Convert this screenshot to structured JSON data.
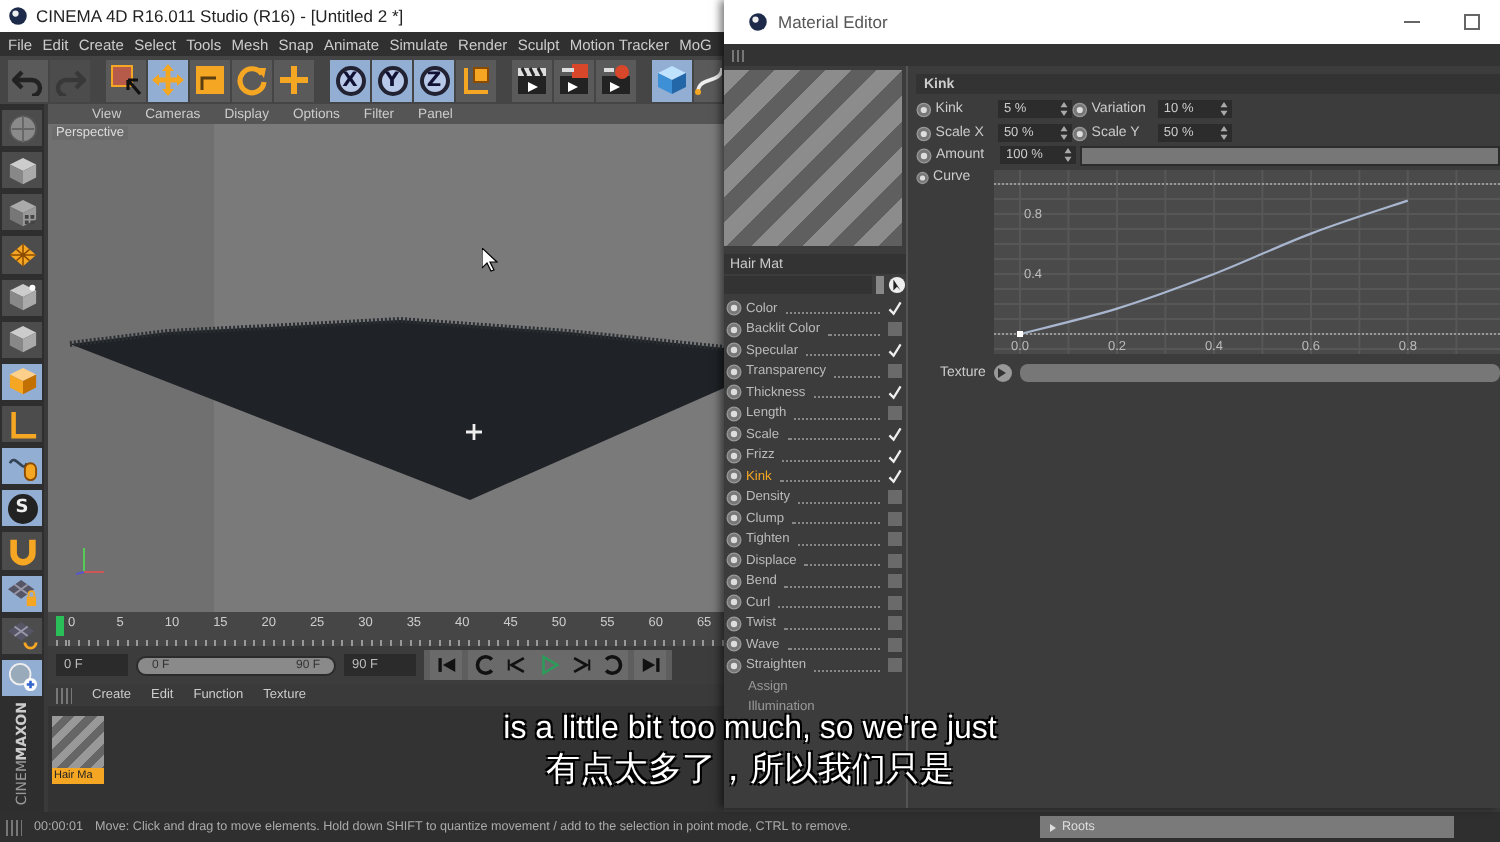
{
  "main_window": {
    "title": "CINEMA 4D R16.011 Studio (R16) - [Untitled 2 *]",
    "menu": [
      "File",
      "Edit",
      "Create",
      "Select",
      "Tools",
      "Mesh",
      "Snap",
      "Animate",
      "Simulate",
      "Render",
      "Sculpt",
      "Motion Tracker",
      "MoG"
    ],
    "toolbar": [
      {
        "kind": "undo",
        "selected": false,
        "disabled": false
      },
      {
        "kind": "redo",
        "selected": false,
        "disabled": true
      },
      {
        "kind": "select",
        "selected": false,
        "disabled": false
      },
      {
        "kind": "move",
        "selected": true,
        "disabled": false
      },
      {
        "kind": "scale",
        "selected": false,
        "disabled": false
      },
      {
        "kind": "rotate",
        "selected": false,
        "disabled": false
      },
      {
        "kind": "add",
        "selected": false,
        "disabled": false
      },
      {
        "kind": "axis",
        "label": "X",
        "selected": true,
        "disabled": false
      },
      {
        "kind": "axis",
        "label": "Y",
        "selected": true,
        "disabled": false
      },
      {
        "kind": "axis",
        "label": "Z",
        "selected": true,
        "disabled": false
      },
      {
        "kind": "coords",
        "selected": false,
        "disabled": false
      },
      {
        "kind": "render-view",
        "selected": false,
        "disabled": false
      },
      {
        "kind": "render",
        "selected": false,
        "disabled": false
      },
      {
        "kind": "render-settings",
        "selected": false,
        "disabled": false
      },
      {
        "kind": "cube",
        "selected": true,
        "disabled": false
      },
      {
        "kind": "spline",
        "selected": false,
        "disabled": false
      }
    ],
    "left_toolbar": [
      {
        "kind": "sphere",
        "selected": false
      },
      {
        "kind": "cube",
        "selected": false
      },
      {
        "kind": "checker-cube",
        "selected": false
      },
      {
        "kind": "texture",
        "selected": false
      },
      {
        "kind": "point-cube",
        "selected": false
      },
      {
        "kind": "cube",
        "selected": false
      },
      {
        "kind": "cube",
        "selected": true
      },
      {
        "kind": "axis-l",
        "selected": false
      },
      {
        "kind": "mouse",
        "selected": true
      },
      {
        "kind": "snap",
        "label": "S",
        "selected": true
      },
      {
        "kind": "magnet",
        "selected": false
      },
      {
        "kind": "grid-lock",
        "selected": true
      },
      {
        "kind": "grid",
        "selected": false
      },
      {
        "kind": "zoom",
        "selected": true
      }
    ],
    "logo": [
      "MAXON",
      "CINEM"
    ],
    "viewport": {
      "menu": [
        "View",
        "Cameras",
        "Display",
        "Options",
        "Filter",
        "Panel"
      ],
      "camera": "Perspective"
    },
    "timeline": {
      "labels": [
        "0",
        "5",
        "10",
        "15",
        "20",
        "25",
        "30",
        "35",
        "40",
        "45",
        "50",
        "55",
        "60",
        "65"
      ],
      "playhead": {
        "level": 0
      }
    },
    "time_controls": {
      "start": "0 F",
      "range": {
        "start": "0 F",
        "end": "90 F",
        "level": 1
      },
      "end": "90 F",
      "transport": [
        {
          "kind": "first"
        },
        {
          "kind": "previous-key"
        },
        {
          "kind": "step-back"
        },
        {
          "kind": "play"
        },
        {
          "kind": "step-forward"
        },
        {
          "kind": "next-key"
        },
        {
          "kind": "last"
        }
      ]
    },
    "material_manager": {
      "menu": [
        "Create",
        "Edit",
        "Function",
        "Texture"
      ],
      "materials": [
        {
          "name": "Hair Ma",
          "selected": true
        }
      ]
    },
    "status_bar": {
      "time": "00:00:01",
      "message": "Move: Click and drag to move elements. Hold down SHIFT to quantize movement / add to the selection in point mode, CTRL to remove.",
      "roots": "Roots"
    }
  },
  "material_editor": {
    "title": "Material Editor",
    "material_name": "Hair Mat",
    "channels": [
      {
        "name": "Color",
        "checked": true,
        "selected": false
      },
      {
        "name": "Backlit Color",
        "checked": false,
        "selected": false
      },
      {
        "name": "Specular",
        "checked": true,
        "selected": false
      },
      {
        "name": "Transparency",
        "checked": false,
        "selected": false
      },
      {
        "name": "Thickness",
        "checked": true,
        "selected": false
      },
      {
        "name": "Length",
        "checked": false,
        "selected": false
      },
      {
        "name": "Scale",
        "checked": true,
        "selected": false
      },
      {
        "name": "Frizz",
        "checked": true,
        "selected": false
      },
      {
        "name": "Kink",
        "checked": true,
        "selected": true
      },
      {
        "name": "Density",
        "checked": false,
        "selected": false
      },
      {
        "name": "Clump",
        "checked": false,
        "selected": false
      },
      {
        "name": "Tighten",
        "checked": false,
        "selected": false
      },
      {
        "name": "Displace",
        "checked": false,
        "selected": false
      },
      {
        "name": "Bend",
        "checked": false,
        "selected": false
      },
      {
        "name": "Curl",
        "checked": false,
        "selected": false
      },
      {
        "name": "Twist",
        "checked": false,
        "selected": false
      },
      {
        "name": "Wave",
        "checked": false,
        "selected": false
      },
      {
        "name": "Straighten",
        "checked": false,
        "selected": false
      }
    ],
    "pages": [
      {
        "label": "Assign",
        "selected": false
      },
      {
        "label": "Illumination",
        "selected": false
      }
    ],
    "panel": {
      "title": "Kink",
      "fields": [
        {
          "label": "Kink",
          "value": "5 %"
        },
        {
          "label": "Variation",
          "value": "10 %"
        },
        {
          "label": "Scale X",
          "value": "50 %"
        },
        {
          "label": "Scale Y",
          "value": "50 %"
        }
      ],
      "amount": {
        "label": "Amount",
        "value": "100 %",
        "level": 1
      },
      "curve": {
        "label": "Curve",
        "chart_data": {
          "type": "line",
          "x": [
            0,
            0.2,
            0.4,
            0.6,
            0.8
          ],
          "values": [
            0,
            0.17,
            0.4,
            0.67,
            0.89
          ],
          "xlim": [
            0,
            0.99
          ],
          "ylim": [
            0,
            1
          ],
          "grid": true,
          "xticks": [
            {
              "value": 0,
              "label": "0.0"
            },
            {
              "value": 0.2,
              "label": "0.2"
            },
            {
              "value": 0.4,
              "label": "0.4"
            },
            {
              "value": 0.6,
              "label": "0.6"
            },
            {
              "value": 0.8,
              "label": "0.8"
            }
          ],
          "yticks": [
            {
              "value": 0.4,
              "label": "0.4"
            },
            {
              "value": 0.8,
              "label": "0.8"
            }
          ]
        }
      },
      "texture": {
        "label": "Texture"
      }
    }
  },
  "subtitles": [
    "is a little bit too much, so we're just",
    "有点太多了，所以我们只是"
  ]
}
